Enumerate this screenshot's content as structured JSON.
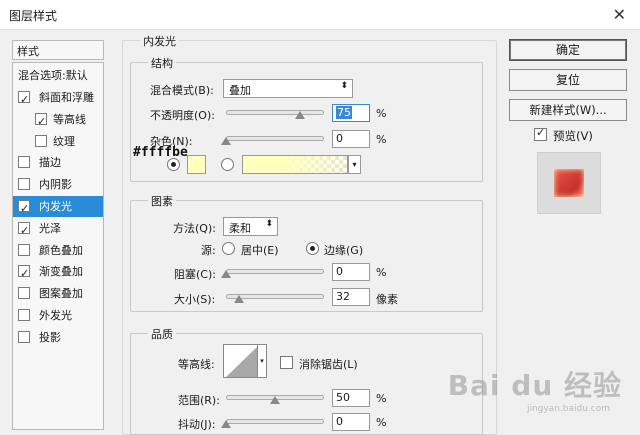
{
  "window": {
    "title": "图层样式",
    "close_glyph": "✕"
  },
  "styles_panel": {
    "header": "样式",
    "blend_options": "混合选项:默认",
    "items": [
      {
        "label": "斜面和浮雕",
        "checked": true,
        "indent": false,
        "selected": false
      },
      {
        "label": "等高线",
        "checked": true,
        "indent": true,
        "selected": false
      },
      {
        "label": "纹理",
        "checked": false,
        "indent": true,
        "selected": false
      },
      {
        "label": "描边",
        "checked": false,
        "indent": false,
        "selected": false
      },
      {
        "label": "内阴影",
        "checked": false,
        "indent": false,
        "selected": false
      },
      {
        "label": "内发光",
        "checked": true,
        "indent": false,
        "selected": true
      },
      {
        "label": "光泽",
        "checked": true,
        "indent": false,
        "selected": false
      },
      {
        "label": "颜色叠加",
        "checked": false,
        "indent": false,
        "selected": false
      },
      {
        "label": "渐变叠加",
        "checked": true,
        "indent": false,
        "selected": false
      },
      {
        "label": "图案叠加",
        "checked": false,
        "indent": false,
        "selected": false
      },
      {
        "label": "外发光",
        "checked": false,
        "indent": false,
        "selected": false
      },
      {
        "label": "投影",
        "checked": false,
        "indent": false,
        "selected": false
      }
    ]
  },
  "inner_glow": {
    "section_title": "内发光",
    "structure": {
      "title": "结构",
      "blend_mode_label": "混合模式(B):",
      "blend_mode_value": "叠加",
      "opacity_label": "不透明度(O):",
      "opacity_value": "75",
      "opacity_slider": 0.75,
      "opacity_unit": "%",
      "noise_label": "杂色(N):",
      "noise_value": "0",
      "noise_slider": 0,
      "noise_unit": "%",
      "color_hex_overlay": "#ffffbe",
      "color_swatch": "#ffffbe",
      "gradient_color": "#ffffbe"
    },
    "elements": {
      "title": "图素",
      "method_label": "方法(Q):",
      "method_value": "柔和",
      "source_label": "源:",
      "source_center": "居中(E)",
      "source_edge": "边缘(G)",
      "source_selected": "edge",
      "choke_label": "阻塞(C):",
      "choke_value": "0",
      "choke_slider": 0,
      "choke_unit": "%",
      "size_label": "大小(S):",
      "size_value": "32",
      "size_slider": 0.13,
      "size_unit": "像素"
    },
    "quality": {
      "title": "品质",
      "contour_label": "等高线:",
      "antialias_label": "消除锯齿(L)",
      "antialias_checked": false,
      "range_label": "范围(R):",
      "range_value": "50",
      "range_slider": 0.5,
      "range_unit": "%",
      "jitter_label": "抖动(J):",
      "jitter_value": "0",
      "jitter_slider": 0,
      "jitter_unit": "%"
    }
  },
  "buttons": {
    "ok": "确定",
    "reset": "复位",
    "new_style": "新建样式(W)...",
    "preview_label": "预览(V)",
    "preview_checked": true
  },
  "watermark": {
    "brand": "Bai du 经验",
    "url": "jingyan.baidu.com"
  }
}
